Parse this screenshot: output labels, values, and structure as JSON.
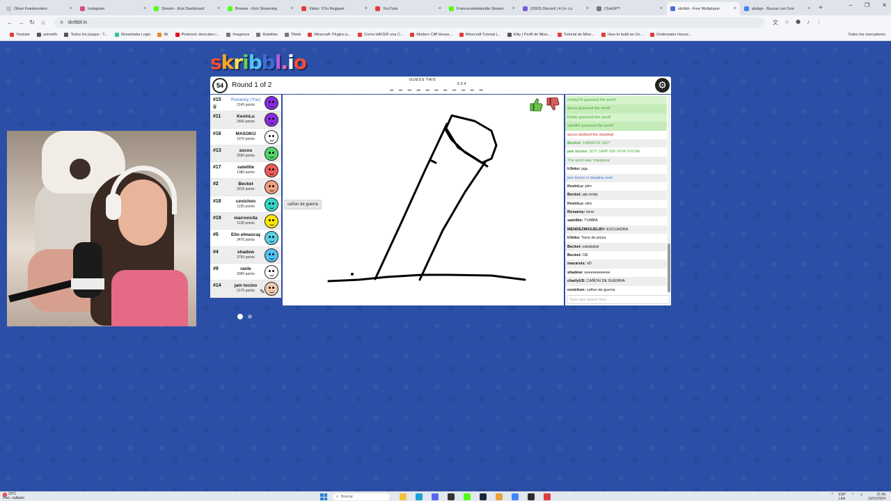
{
  "browser": {
    "tabs": [
      {
        "title": "Oliver Frankenstein",
        "color": "#c2c2c2"
      },
      {
        "title": "Instagram",
        "color": "#d64b8c"
      },
      {
        "title": "Stream - Kick Dashboard",
        "color": "#53fc18"
      },
      {
        "title": "Browse - Kick Streaming",
        "color": "#53fc18"
      },
      {
        "title": "Video: YOu Reggaet",
        "color": "#e43c3c"
      },
      {
        "title": "YouTube",
        "color": "#e43c3c"
      },
      {
        "title": "Franconvidelaturble Stream",
        "color": "#53fc18"
      },
      {
        "title": "(2063) Discord | 4 G+ Lo",
        "color": "#7b5cd6"
      },
      {
        "title": "ChatGPT",
        "color": "#777777"
      },
      {
        "title": "skribbl - Free Multiplayer",
        "color": "#4b6fd6"
      },
      {
        "title": "abdaje - Buscar con Goo",
        "color": "#4285f4"
      }
    ],
    "active_tab": 9,
    "new_tab": "+",
    "window_controls": [
      "–",
      "❐",
      "✕"
    ],
    "url": "skribbl.io",
    "bookmarks": [
      {
        "label": "Youtube",
        "color": "#e43c3c"
      },
      {
        "label": "animeflv",
        "color": "#555555"
      },
      {
        "label": "Todos los juegos - T...",
        "color": "#555555"
      },
      {
        "label": "Streamlabs Login",
        "color": "#31c3a2"
      },
      {
        "label": "Ali",
        "color": "#e8862a"
      },
      {
        "label": "Pinterest: descubre i...",
        "color": "#e60023"
      },
      {
        "label": "Imagenes",
        "color": "#777777"
      },
      {
        "label": "Ruletitas",
        "color": "#777777"
      },
      {
        "label": "Tiktok",
        "color": "#777777"
      },
      {
        "label": "Minecraft: Plugins p...",
        "color": "#e43c3c"
      },
      {
        "label": "Como HACER una C...",
        "color": "#e43c3c"
      },
      {
        "label": "Modern Cliff House...",
        "color": "#e43c3c"
      },
      {
        "label": "Minecraft Tutorial |...",
        "color": "#e43c3c"
      },
      {
        "label": "Kitty | Perfil de Mine...",
        "color": "#555555"
      },
      {
        "label": "Tutorial de Mine...",
        "color": "#e43c3c"
      },
      {
        "label": "How to build an Un...",
        "color": "#e43c3c"
      },
      {
        "label": "Underwater House...",
        "color": "#e43c3c"
      }
    ],
    "all_bookmarks": "Todos los marcadores"
  },
  "game": {
    "logo": "skribbl.io",
    "logo_colors": [
      "#ef4d3c",
      "#f5a623",
      "#ffe14d",
      "#5fd35a",
      "#4fc3f7",
      "#3b6fd6",
      "#b15be8",
      "#f06ab2",
      "#ffffff",
      "#ef4d3c"
    ],
    "timer": "54",
    "round": "Round 1 of 2",
    "guess_label": "GUESS THIS",
    "word_blanks": "_ _ _ _ _   _ _   _ _ _ _",
    "word_lengths": "5 2 4",
    "settings_icon": "gear-icon",
    "players": [
      {
        "rank": "#15",
        "name": "Roxanny (You)",
        "points": "2145 points",
        "avatar": "#8a2be2",
        "you": true,
        "crown": true
      },
      {
        "rank": "#11",
        "name": "KevinLu",
        "points": "2600 points",
        "avatar": "#8a2be2"
      },
      {
        "rank": "#16",
        "name": "MASOKU",
        "points": "1970 points",
        "avatar": "#ffffff"
      },
      {
        "rank": "#13",
        "name": "ascos",
        "points": "2550 points",
        "avatar": "#4fd66b"
      },
      {
        "rank": "#17",
        "name": "satellite",
        "points": "1380 points",
        "avatar": "#ee5a5a"
      },
      {
        "rank": "#2",
        "name": "Becket",
        "points": "3915 points",
        "avatar": "#f0a080"
      },
      {
        "rank": "#18",
        "name": "cevichon",
        "points": "1155 points",
        "avatar": "#35d6c8"
      },
      {
        "rank": "#19",
        "name": "marroncita",
        "points": "1130 points",
        "avatar": "#ffe600"
      },
      {
        "rank": "#5",
        "name": "Ello elmascap",
        "points": "3475 points",
        "avatar": "#5ad1e8"
      },
      {
        "rank": "#4",
        "name": "shadow",
        "points": "3750 points",
        "avatar": "#4fc3f7"
      },
      {
        "rank": "#9",
        "name": "ranle",
        "points": "2960 points",
        "avatar": "#ffffff"
      },
      {
        "rank": "#14",
        "name": "jam tocino",
        "points": "2175 points",
        "avatar": "#f0c8b0",
        "drawing": true
      }
    ],
    "tooltip": "cañon de guerra",
    "like_icon": "thumbs-up-icon",
    "dislike_icon": "thumbs-down-icon",
    "chat": [
      {
        "type": "guessed",
        "text": "charlyUS guessed the word!"
      },
      {
        "type": "guessed",
        "text": "ascos guessed the word!"
      },
      {
        "type": "guessed",
        "text": "lr3nko guessed the word!"
      },
      {
        "type": "guessed",
        "text": "satellite guessed the word!"
      },
      {
        "type": "disliked",
        "text": "ascos disliked the drawing!"
      },
      {
        "type": "liked",
        "user": "Becket:",
        "text": "CARACOL NO?"
      },
      {
        "type": "liked",
        "user": "jam tocino:",
        "text": "SOY SIMP SIN VIDA SOCIAL"
      },
      {
        "type": "liked",
        "text": "The word was 'mariposa'"
      },
      {
        "type": "normal",
        "user": "lr3nko:",
        "text": "jaja"
      },
      {
        "type": "info",
        "text": "jam tocino is drawing now!"
      },
      {
        "type": "normal",
        "user": "KevinLu:",
        "text": "ptm"
      },
      {
        "type": "normal",
        "user": "Becket:",
        "text": "ala mrda"
      },
      {
        "type": "normal",
        "user": "KevinLu:",
        "text": "otro"
      },
      {
        "type": "normal",
        "user": "Roxanny:",
        "text": "torre"
      },
      {
        "type": "normal",
        "user": "satellite:",
        "text": "TUMBA"
      },
      {
        "type": "normal",
        "user": "MENDEZMIGUELBV:",
        "text": "ESCUADRA"
      },
      {
        "type": "normal",
        "user": "lr3nko:",
        "text": "Torre de pizza"
      },
      {
        "type": "normal",
        "user": "Becket:",
        "text": "xdxdxdxd"
      },
      {
        "type": "normal",
        "user": "Becket:",
        "text": "OE"
      },
      {
        "type": "normal",
        "user": "macaruis:",
        "text": "xD"
      },
      {
        "type": "normal",
        "user": "shadow:",
        "text": "oeeeeeeeeeee"
      },
      {
        "type": "normal",
        "user": "charlyUS:",
        "text": "CAÑON DE GUERRA"
      },
      {
        "type": "normal",
        "user": "cevichon:",
        "text": "cañon de guerra"
      }
    ],
    "chat_placeholder": "Type your guess here..."
  },
  "taskbar": {
    "weather_temp": "23°C",
    "weather_desc": "Parc. nublado",
    "weather_badge": "1",
    "search": "Buscar",
    "apps": [
      {
        "name": "file-explorer-icon",
        "color": "#f3c43b"
      },
      {
        "name": "edge-icon",
        "color": "#1aa1d6"
      },
      {
        "name": "discord-icon",
        "color": "#5865f2"
      },
      {
        "name": "obs-icon",
        "color": "#333333"
      },
      {
        "name": "kick-icon",
        "color": "#53fc18"
      },
      {
        "name": "steam-icon",
        "color": "#1b2838"
      },
      {
        "name": "chrome-icon",
        "color": "#e8a23a"
      },
      {
        "name": "mail-icon",
        "color": "#4285f4"
      },
      {
        "name": "capture-icon",
        "color": "#2b2b2b"
      },
      {
        "name": "roblox-icon",
        "color": "#e03c3c"
      }
    ],
    "lang": "ESP",
    "lang2": "LAA",
    "time": "21:49",
    "date": "16/01/2024"
  }
}
